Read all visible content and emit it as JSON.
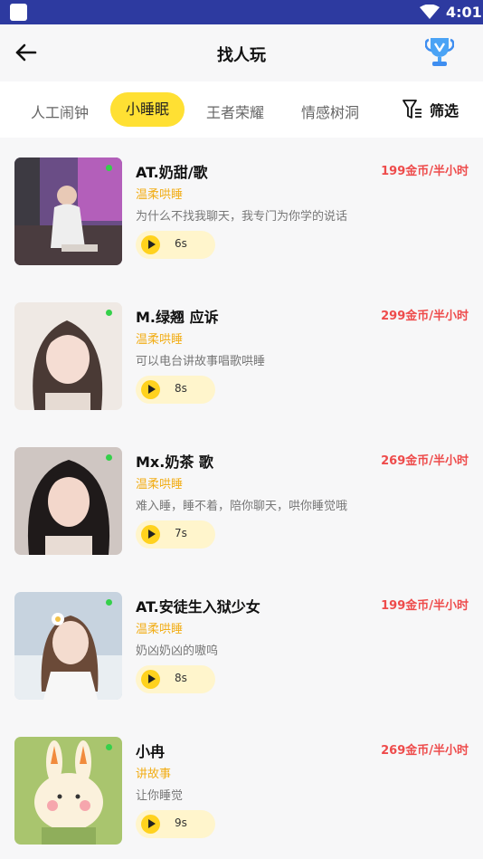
{
  "status_bar": {
    "time": "4:01"
  },
  "header": {
    "title": "找人玩",
    "back_icon": "arrow-left-icon",
    "trophy_icon": "trophy-icon"
  },
  "tabs": [
    {
      "label": "人工闹钟",
      "active": false
    },
    {
      "label": "小睡眠",
      "active": true
    },
    {
      "label": "王者荣耀",
      "active": false
    },
    {
      "label": "情感树洞",
      "active": false
    }
  ],
  "filter": {
    "label": "筛选",
    "icon": "filter-icon"
  },
  "colors": {
    "accent": "#ffe033",
    "price": "#ee4b4b",
    "tag": "#f2ae18",
    "status_bar": "#2d3aa0",
    "online": "#35d04a"
  },
  "users": [
    {
      "name": "AT.奶甜/歌",
      "price": "199金币/半小时",
      "tag": "温柔哄睡",
      "description": "为什么不找我聊天，我专门为你学的说话",
      "duration": "6s"
    },
    {
      "name": "M.绿翘   应诉",
      "price": "299金币/半小时",
      "tag": "温柔哄睡",
      "description": "可以电台讲故事唱歌哄睡",
      "duration": "8s"
    },
    {
      "name": "Mx.奶茶    歌",
      "price": "269金币/半小时",
      "tag": "温柔哄睡",
      "description": "难入睡，睡不着，陪你聊天，哄你睡觉哦",
      "duration": "7s"
    },
    {
      "name": "AT.安徒生入狱少女",
      "price": "199金币/半小时",
      "tag": "温柔哄睡",
      "description": "奶凶奶凶的嗷呜",
      "duration": "8s"
    },
    {
      "name": "小冉",
      "price": "269金币/半小时",
      "tag": "讲故事",
      "description": "让你睡觉",
      "duration": "9s"
    }
  ]
}
